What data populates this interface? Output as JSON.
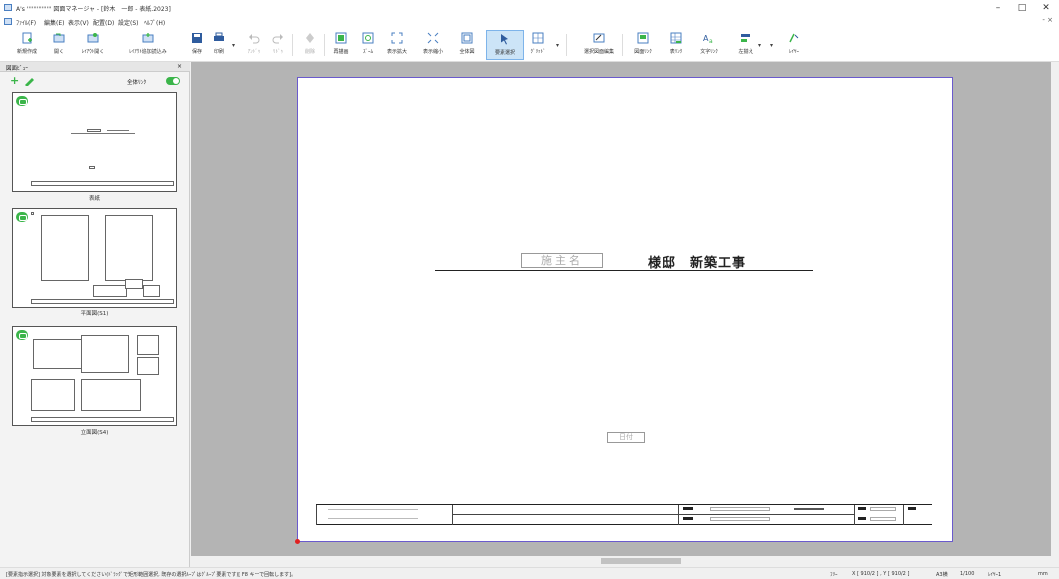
{
  "window": {
    "title": "A's ''''''''''''''' 図面マネージャ - [鈴木　一郎 - 表紙.2023]",
    "controls": {
      "minimize": "–",
      "maximize": "□",
      "close": "✕"
    }
  },
  "menu": {
    "items": [
      "ﾌｧｲﾙ(F)",
      "編集(E)",
      "表示(V)",
      "配置(D)",
      "設定(S)",
      "ﾍﾙﾌﾟ(H)"
    ],
    "mdi_controls": "- ×"
  },
  "toolbar": {
    "buttons": [
      {
        "label": "新規作成",
        "icon": "new-document-icon"
      },
      {
        "label": "開く",
        "icon": "open-folder-icon"
      },
      {
        "label": "ﾚｲｱｳﾄ開く",
        "icon": "layout-open-icon"
      },
      {
        "label": "ﾚｲｱｳﾄ追加読込み",
        "icon": "layout-add-icon"
      },
      {
        "label": "保存",
        "icon": "save-icon"
      },
      {
        "label": "印刷",
        "icon": "print-icon"
      },
      {
        "label": "ｱﾝﾄﾞｩ",
        "icon": "undo-icon"
      },
      {
        "label": "ﾘﾄﾞｩ",
        "icon": "redo-icon"
      },
      {
        "label": "削除",
        "icon": "delete-icon"
      },
      {
        "label": "再描画",
        "icon": "redraw-icon"
      },
      {
        "label": "ｽﾞｰﾑ",
        "icon": "zoom-icon"
      },
      {
        "label": "表示拡大",
        "icon": "zoom-in-icon"
      },
      {
        "label": "表示縮小",
        "icon": "zoom-out-icon"
      },
      {
        "label": "全体図",
        "icon": "fit-all-icon"
      },
      {
        "label": "要素選択",
        "icon": "select-pointer-icon"
      },
      {
        "label": "ｸﾞﾘｯﾄﾞ",
        "icon": "grid-icon"
      },
      {
        "label": "選択図面編集",
        "icon": "edit-drawing-icon"
      },
      {
        "label": "図面ﾘﾝｸ",
        "icon": "drawing-link-icon"
      },
      {
        "label": "表ﾘﾝｸ",
        "icon": "table-link-icon"
      },
      {
        "label": "文字ﾘﾝｸ",
        "icon": "text-link-icon"
      },
      {
        "label": "左揃え",
        "icon": "align-left-icon"
      },
      {
        "label": "ﾚｲﾔｰ",
        "icon": "layer-icon"
      }
    ]
  },
  "side_panel": {
    "title": "図面ﾋﾞｭｰ",
    "close": "×",
    "add": "+",
    "link_all_label": "全体ﾘﾝｸ",
    "thumbnails": [
      {
        "label": "表紙"
      },
      {
        "label": "平面図(S1)"
      },
      {
        "label": "立面図(S4)"
      }
    ]
  },
  "sheet": {
    "owner_placeholder": "施主名",
    "project_suffix": "様邸　新築工事",
    "date_placeholder": "日付"
  },
  "status_bar": {
    "message": "[要素指示選択]  対象要素を選択してください(ﾄﾞﾗｯｸﾞで矩形範囲選択, 既存の選択ﾙｰﾌﾟはｸﾞﾙｰﾌﾟ要素です)[ F8  キーで回転します]。",
    "snap": "ﾌﾘｰ",
    "coords": "X [ 910/2 ] , Y [ 910/2 ]",
    "paper": "A3横",
    "scale": "1/100",
    "layer": "ﾚｲﾔｰ1",
    "unit": "mm"
  },
  "colors": {
    "accent_green": "#3bb54a",
    "sheet_border": "#6a5acd",
    "active_tool": "#cce4f7"
  }
}
